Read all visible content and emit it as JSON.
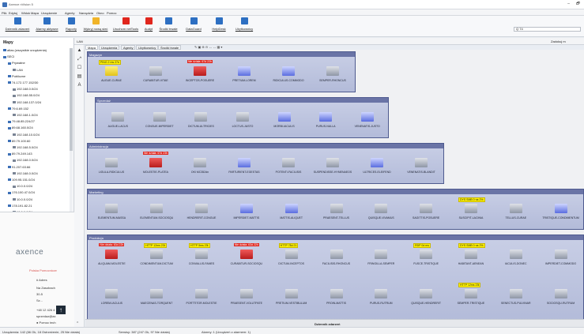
{
  "window": {
    "title": "Axence nVision 5",
    "min": "–",
    "restore": "🗗"
  },
  "menu": [
    "Plik",
    "Edytuj",
    "Widok",
    "Mapa",
    "Urządzenie",
    "Agenty",
    "Narzędzia",
    "Okno",
    "Pomoc"
  ],
  "toolbar": [
    {
      "label": "Dziennik zdarzeń",
      "color": "#2d6fc2"
    },
    {
      "label": "Alarmy aktywne",
      "color": "#2d6fc2"
    },
    {
      "label": "Raporty",
      "color": "#2d6fc2"
    },
    {
      "label": "Wykryj nową sieć",
      "color": "#f0b429"
    },
    {
      "label": "Uruchom netTools",
      "color": "#e0261d"
    },
    {
      "label": "Audyt",
      "color": "#e0261d"
    },
    {
      "label": "Środki trwałe",
      "color": "#2d6fc2"
    },
    {
      "label": "DataGuard",
      "color": "#2d6fc2"
    },
    {
      "label": "HelpDesk",
      "color": "#2d6fc2"
    },
    {
      "label": "Użytkownicy",
      "color": "#2d6fc2"
    }
  ],
  "search": {
    "value": "Q 74"
  },
  "favorites_link": "Zadokuj m",
  "sidebar": {
    "title": "Mapy",
    "items": [
      {
        "label": "atlas (wszystkie urządzenia)",
        "indent": 0
      },
      {
        "label": "SECI",
        "indent": 0
      },
      {
        "label": "Prywatne",
        "indent": 1
      },
      {
        "label": "LAN",
        "indent": 2
      },
      {
        "label": "Publiczne",
        "indent": 1
      },
      {
        "label": "74.172.177.152/30",
        "indent": 1
      },
      {
        "label": "192.168.0.0/24",
        "indent": 2
      },
      {
        "label": "192.168.55.0/24",
        "indent": 2
      },
      {
        "label": "192.168.137.0/24",
        "indent": 2
      },
      {
        "label": "79.6.69.152",
        "indent": 1
      },
      {
        "label": "192.168.1.0/24",
        "indent": 2
      },
      {
        "label": "79.48.85.224/27",
        "indent": 1
      },
      {
        "label": "89.68.160.0/24",
        "indent": 1
      },
      {
        "label": "192.168.10.0/24",
        "indent": 2
      },
      {
        "label": "89.79.100.60",
        "indent": 1
      },
      {
        "label": "192.168.5.0/24",
        "indent": 2
      },
      {
        "label": "89.79.249.143",
        "indent": 1
      },
      {
        "label": "192.168.0.0/24",
        "indent": 2
      },
      {
        "label": "91.207.63.66",
        "indent": 1
      },
      {
        "label": "192.168.0.0/24",
        "indent": 2
      },
      {
        "label": "109.95.151.0/24",
        "indent": 1
      },
      {
        "label": "10.0.0.0/24",
        "indent": 2
      },
      {
        "label": "176.100.47.0/24",
        "indent": 1
      },
      {
        "label": "10.0.0.0/24",
        "indent": 2
      },
      {
        "label": "178.191.82.21",
        "indent": 1
      },
      {
        "label": "10.0.0.0/24",
        "indent": 2
      },
      {
        "label": "193.25.0.0",
        "indent": 1
      },
      {
        "label": "192.168.0.0/24",
        "indent": 2
      }
    ],
    "footer": "Co nowego?"
  },
  "brand": {
    "logo": "axence",
    "subtitle": "Polska Pomocnicze",
    "lines": [
      "# Adres",
      "Na Zasobach",
      "30-5",
      "Sz...",
      "+48 12 426 4",
      "sprzedaz@ax",
      "● Pomoc tech"
    ]
  },
  "main": {
    "map_label": "LAN",
    "tabs": [
      "Mapa",
      "Urządzenia",
      "Agenty",
      "Użytkownicy",
      "Środki trwałe"
    ],
    "tools": "✎  ▣  ⊕  ⊖  ↔  ↔   ▦ ▾"
  },
  "vtools": [
    "▲",
    "⤢",
    "☐",
    "▤",
    "A"
  ],
  "groups": [
    {
      "title": "Magazyn",
      "devices": [
        {
          "name": "AUGUE-CURAE",
          "color": "yellow",
          "badge": "PING 2 ms 27e",
          "badge_type": "yellow"
        },
        {
          "name": "CURABITUR-VITAE",
          "color": "gray"
        },
        {
          "name": "INCEPTOS-POSUERE",
          "color": "red",
          "badge": "Nie działa: 67d 22h",
          "badge_type": "red"
        },
        {
          "name": "PRETIUM-LOREM",
          "color": "blue"
        },
        {
          "name": "RIDICULUS-COMMODO",
          "color": "blue"
        },
        {
          "name": "SEMPER-RHONCUS",
          "color": "gray"
        }
      ]
    },
    {
      "title": "Sprzedaż",
      "devices": [
        {
          "name": "AUGUE-LACUS",
          "color": "gray"
        },
        {
          "name": "CONGUE-IMPERDIET",
          "color": "gray"
        },
        {
          "name": "DICTUM-ULTRICIES",
          "color": "gray"
        },
        {
          "name": "LOCTUS-JUSTO",
          "color": "gray"
        },
        {
          "name": "MORBI-IACULIS",
          "color": "blue"
        },
        {
          "name": "PURUS-NULLA",
          "color": "blue"
        },
        {
          "name": "VENENATIS-JUSTO",
          "color": "blue"
        }
      ]
    },
    {
      "title": "Administracja",
      "devices": [
        {
          "name": "LIGULA-RIDICULUS",
          "color": "gray"
        },
        {
          "name": "MOLESTIE-PLATEA",
          "color": "red",
          "badge": "Nie działa: 67d 23h",
          "badge_type": "red"
        },
        {
          "name": "OKI MC352dn",
          "color": "gray"
        },
        {
          "name": "PARTURIENT-EGESTAS",
          "color": "blue"
        },
        {
          "name": "POTENTI-FACILISIS",
          "color": "gray"
        },
        {
          "name": "SUSPENDISSE-HYMENAEOS",
          "color": "gray"
        },
        {
          "name": "ULTRICES-ELEIFEND",
          "color": "blue"
        },
        {
          "name": "VENENATIS-BLANDIT",
          "color": "gray"
        }
      ]
    },
    {
      "title": "Marketing",
      "devices": [
        {
          "name": "ELEMENTUM-MASSA",
          "color": "gray"
        },
        {
          "name": "ELEMENTUM-SOCIOSQU",
          "color": "gray"
        },
        {
          "name": "HENDRERIT-CONGUE",
          "color": "gray"
        },
        {
          "name": "IMPERDIET-MATTIS",
          "color": "blue"
        },
        {
          "name": "MATTIS-ALIQUET",
          "color": "blue"
        },
        {
          "name": "PRAESENT-TELLUS",
          "color": "gray"
        },
        {
          "name": "QUISQUE-VIVAMUS",
          "color": "gray"
        },
        {
          "name": "SAGITTIS-POSUERE",
          "color": "gray"
        },
        {
          "name": "SUSCIPIT-LACINIA",
          "color": "gray",
          "badge": "DYS SMB 0 na 2%",
          "badge_type": "yellow"
        },
        {
          "name": "TELLUS-CURAE",
          "color": "gray"
        },
        {
          "name": "TRISTIQUE-CONDIMENTUM",
          "color": "blue"
        }
      ]
    },
    {
      "title": "Produkcja",
      "devices": [
        {
          "name": "ALIQUAM-MOLESTIE",
          "color": "red",
          "badge": "Nie działa: 63d 22h",
          "badge_type": "red"
        },
        {
          "name": "CONDIMENTUM-DICTUM",
          "color": "gray",
          "badge": "HTTP 12ms 23t",
          "badge_type": "yellow"
        },
        {
          "name": "CONVALLIS-FAMES",
          "color": "gray",
          "badge": "HTTP 5ms 23t",
          "badge_type": "yellow"
        },
        {
          "name": "CURABITUR-SOCIOSQU",
          "color": "red",
          "badge": "Nie działa: 63d 22h",
          "badge_type": "red"
        },
        {
          "name": "DICTUM-INCEPTOS",
          "color": "gray",
          "badge": "HTTP 78d 21",
          "badge_type": "yellow"
        },
        {
          "name": "FACILISIS-RHONCUS",
          "color": "gray"
        },
        {
          "name": "FRINGILLA-SEMPER",
          "color": "gray"
        },
        {
          "name": "FUSCE-TRISTIQUE",
          "color": "gray",
          "badge": "RDP 0d ms",
          "badge_type": "yellow"
        },
        {
          "name": "HABITANT-AENEAN",
          "color": "gray",
          "badge": "DYS SMB 0 na 2%",
          "badge_type": "yellow"
        },
        {
          "name": "IACULIS-DONEC",
          "color": "gray"
        },
        {
          "name": "IMPERDIET-COMMODO",
          "color": "gray"
        },
        {
          "name": "LOREM-IACULIS",
          "color": "gray"
        },
        {
          "name": "MAECENAS-TORQUENT",
          "color": "gray"
        },
        {
          "name": "PORTTITOR-MOLESTIE",
          "color": "gray"
        },
        {
          "name": "PRAESENT-VOLUTPATE",
          "color": "gray"
        },
        {
          "name": "PRETIUM-VESTIBULUM",
          "color": "gray"
        },
        {
          "name": "PROIN-MATTIS",
          "color": "gray"
        },
        {
          "name": "PURUS-RUTRUM",
          "color": "gray"
        },
        {
          "name": "QUISQUE-HENDRERIT",
          "color": "gray"
        },
        {
          "name": "SEMPER-TRISTIQUE",
          "color": "gray",
          "badge": "HTTP 12ms 23t",
          "badge_type": "yellow"
        },
        {
          "name": "SENECTUS-PULVINAR",
          "color": "gray"
        },
        {
          "name": "SOCIOSQU-RUTRUM",
          "color": "gray"
        }
      ]
    }
  ],
  "events_bar": {
    "title": "Dziennik zdarzeń"
  },
  "status": {
    "devices": "Urządzenia: 142 (66 Ok, 18 Ostrzeżenie, 25 Nie działa)",
    "services": "Serwisy: 387 (247 Ok, 97 Nie działa)",
    "alarms": "Alarmy: 1 (Urządzeń z alarmem: 1)"
  }
}
